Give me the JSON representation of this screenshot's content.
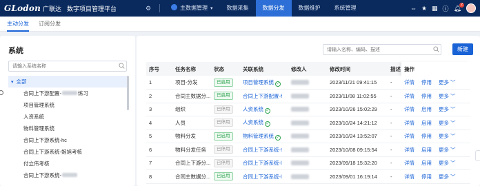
{
  "topbar": {
    "brand": "GLodon",
    "brand_cn": "广联达",
    "app_title": "数字项目管理平台",
    "menu": [
      {
        "label": "主数据管理",
        "dropdown": true
      },
      {
        "label": "数据采集",
        "active": false
      },
      {
        "label": "数据分发",
        "active": true
      },
      {
        "label": "数据维护",
        "active": false
      },
      {
        "label": "系统管理",
        "active": false
      }
    ],
    "notification_count": "2"
  },
  "subtabs": [
    {
      "label": "主动分发",
      "active": true
    },
    {
      "label": "订阅分发",
      "active": false
    }
  ],
  "left": {
    "title": "系统",
    "search_placeholder": "请输入系统名称",
    "tree": [
      {
        "label": "全部",
        "root": true
      },
      {
        "label": "合同上下游配置-",
        "suffix": "练习",
        "blurred": true
      },
      {
        "label": "项目管理系统"
      },
      {
        "label": "人资系统"
      },
      {
        "label": "物料管理系统"
      },
      {
        "label": "合同上下游系统-hc"
      },
      {
        "label": "合同上下游系统-姬旭考核"
      },
      {
        "label": "付立伟考核"
      },
      {
        "label": "合同上下游系统-",
        "blurred": true
      }
    ]
  },
  "right": {
    "search_placeholder": "请输入名称、编码、描述",
    "new_button": "新建",
    "columns": [
      "序号",
      "任务名称",
      "状态",
      "关联系统",
      "修改人",
      "修改时间",
      "描述",
      "操作"
    ],
    "rows": [
      {
        "no": "1",
        "name": "项目-分发",
        "status": "已启用",
        "status_on": true,
        "system": "项目管理系统",
        "check": true,
        "time": "2023/11/21 09:41:15",
        "desc": "-",
        "actions": [
          "详情",
          "停用",
          "更多"
        ]
      },
      {
        "no": "2",
        "name": "合同主数据分...",
        "status": "已启用",
        "status_on": true,
        "system": "合同上下游配置-f",
        "check": false,
        "time": "2023/11/08 11:02:55",
        "desc": "-",
        "actions": [
          "详情",
          "停用",
          "更多"
        ]
      },
      {
        "no": "3",
        "name": "组织",
        "status": "已停用",
        "status_on": false,
        "system": "人资系统",
        "check": true,
        "time": "2023/10/26 15:02:29",
        "desc": "-",
        "actions": [
          "详情",
          "启用",
          "更多"
        ]
      },
      {
        "no": "4",
        "name": "人员",
        "status": "已停用",
        "status_on": false,
        "system": "人资系统",
        "check": true,
        "time": "2023/10/24 14:21:12",
        "desc": "-",
        "actions": [
          "详情",
          "启用",
          "更多"
        ]
      },
      {
        "no": "5",
        "name": "物料分发",
        "status": "已启用",
        "status_on": true,
        "system": "物料管理系统",
        "check": true,
        "time": "2023/10/24 13:52:07",
        "desc": "-",
        "actions": [
          "详情",
          "停用",
          "更多"
        ]
      },
      {
        "no": "6",
        "name": "物料分发任务",
        "status": "已停用",
        "status_on": false,
        "system": "合同上下游系统-!",
        "check": false,
        "time": "2023/10/08 09:15:54",
        "desc": "-",
        "actions": [
          "详情",
          "启用",
          "更多"
        ]
      },
      {
        "no": "7",
        "name": "合同上下游分...",
        "status": "已停用",
        "status_on": false,
        "system": "合同上下游系统-l",
        "check": false,
        "time": "2023/09/18 15:32:20",
        "desc": "-",
        "actions": [
          "详情",
          "启用",
          "更多"
        ]
      },
      {
        "no": "8",
        "name": "合同主数据分...",
        "status": "已启用",
        "status_on": true,
        "system": "合同上下游系统-l",
        "check": false,
        "time": "2023/09/01 16:19:14",
        "desc": "-",
        "actions": [
          "详情",
          "停用",
          "更多"
        ]
      }
    ]
  },
  "colors": {
    "topbar": "#0a2a5e",
    "accent": "#1a63d6",
    "enabled": "#2ea44f"
  }
}
